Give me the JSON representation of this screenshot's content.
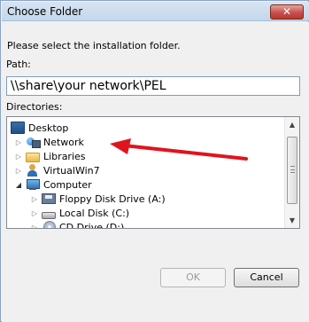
{
  "dialog": {
    "title": "Choose Folder",
    "close_label": "✕",
    "prompt": "Please select the installation folder.",
    "path_label": "Path:",
    "path_value": "\\\\share\\your network\\PEL",
    "directories_label": "Directories:",
    "ok_label": "OK",
    "cancel_label": "Cancel"
  },
  "tree": {
    "items": [
      {
        "label": "Desktop",
        "icon": "desktop-icon",
        "level": 0,
        "expander": "none"
      },
      {
        "label": "Network",
        "icon": "network-icon",
        "level": 1,
        "expander": "collapsed"
      },
      {
        "label": "Libraries",
        "icon": "libraries-folder-icon",
        "level": 1,
        "expander": "collapsed"
      },
      {
        "label": "VirtualWin7",
        "icon": "user-icon",
        "level": 1,
        "expander": "collapsed"
      },
      {
        "label": "Computer",
        "icon": "computer-icon",
        "level": 1,
        "expander": "expanded"
      },
      {
        "label": "Floppy Disk Drive (A:)",
        "icon": "floppy-disk-icon",
        "level": 2,
        "expander": "collapsed"
      },
      {
        "label": "Local Disk (C:)",
        "icon": "hard-disk-icon",
        "level": 2,
        "expander": "collapsed"
      },
      {
        "label": "CD Drive (D:)",
        "icon": "cd-drive-icon",
        "level": 2,
        "expander": "collapsed"
      }
    ]
  },
  "annotation": {
    "color": "#e0141e",
    "points_to": "Network"
  },
  "colors": {
    "title_bar": "#c4d7ec",
    "close_button": "#c75050",
    "input_border": "#7f9db9"
  }
}
